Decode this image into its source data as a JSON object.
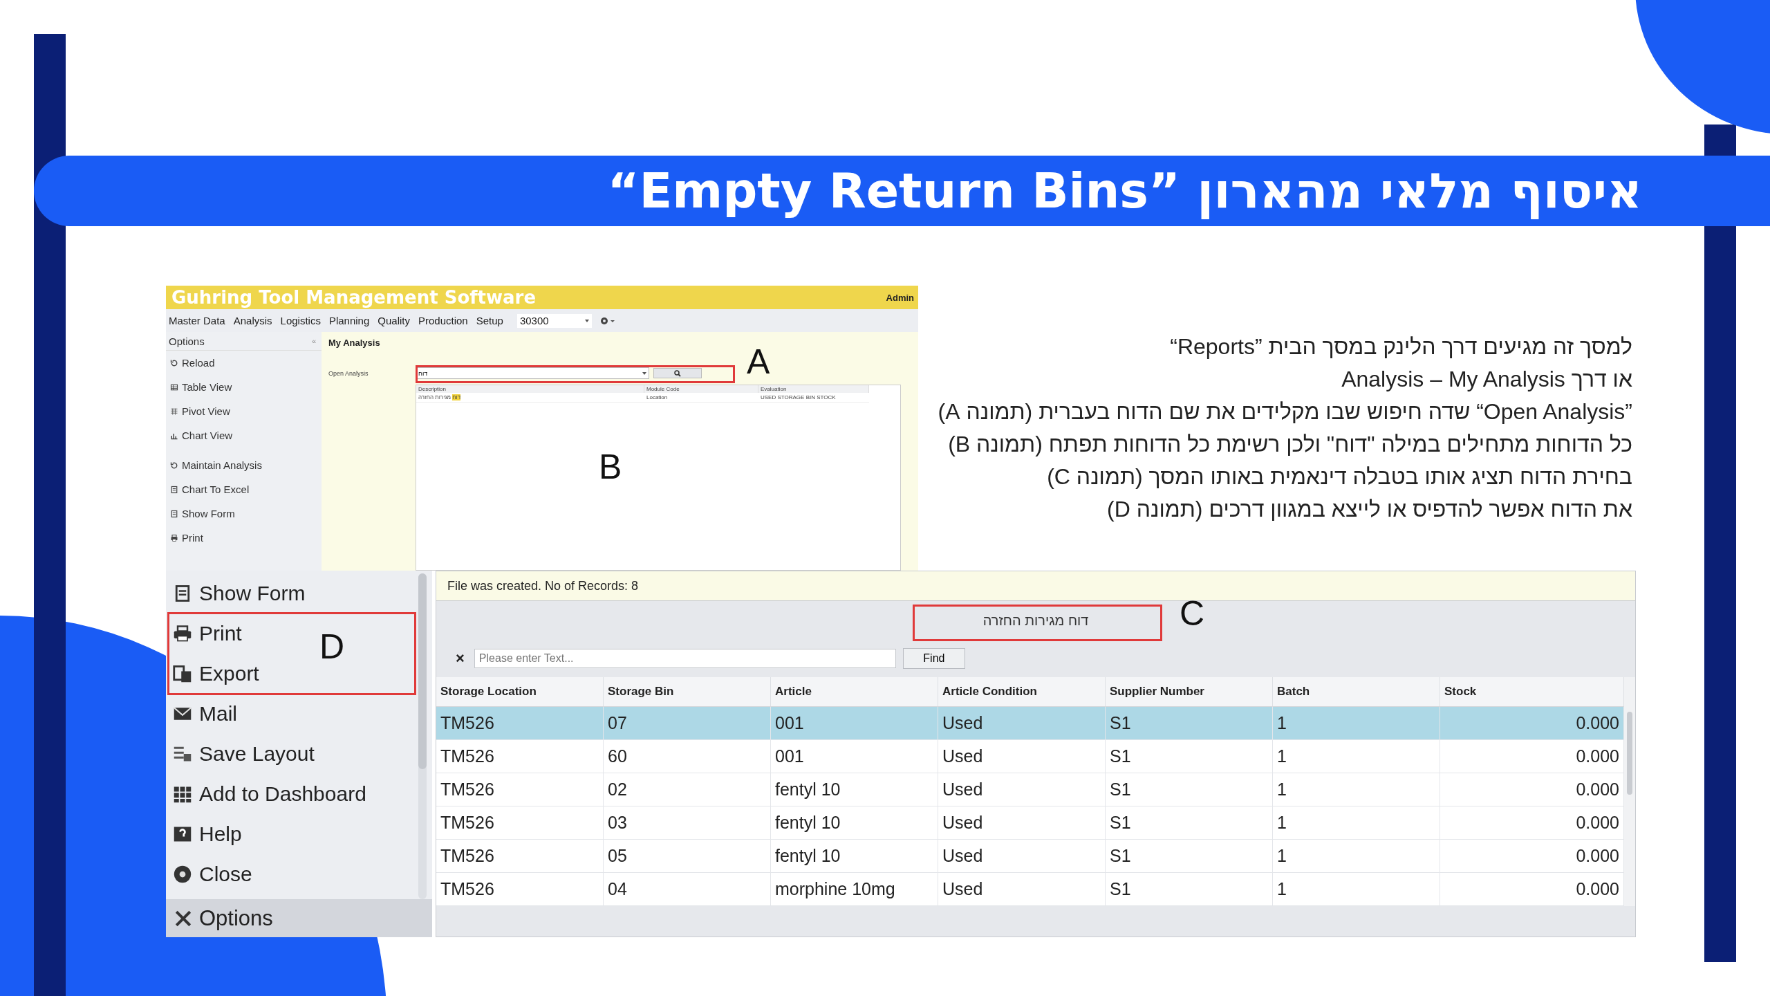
{
  "slide": {
    "title": "איסוף מלאי מהארון ”Empty Return Bins“",
    "notes": [
      "למסך זה מגיעים דרך הלינק במסך הבית ”Reports“",
      "או דרך Analysis – My Analysis",
      "”Open Analysis“ שדה חיפוש שבו מקלידים את שם הדוח בעברית (תמונה A)",
      "כל הדוחות מתחילים במילה \"דוח\" ולכן רשימת כל הדוחות תפתח (תמונה B)",
      "בחירת הדוח תציג אותו בטבלה דינאמית באותו המסך  (תמונה C)",
      "את הדוח אפשר להדפיס או לייצא במגוון דרכים (תמונה D)"
    ]
  },
  "analysis_window": {
    "app_title": "Guhring Tool Management Software",
    "user": "Admin",
    "menu": [
      "Master Data",
      "Analysis",
      "Logistics",
      "Planning",
      "Quality",
      "Production",
      "Setup"
    ],
    "company": "30300",
    "sidebar_title": "Options",
    "sidebar_collapse": "«",
    "sidebar_items": [
      "Reload",
      "Table View",
      "Pivot View",
      "Chart View",
      "Maintain Analysis",
      "Chart To Excel",
      "Show Form",
      "Print"
    ],
    "page_title": "My Analysis",
    "field_label": "Open Analysis",
    "search_value": "דוח",
    "results": {
      "columns": [
        "Description",
        "Module Code",
        "Evaluation"
      ],
      "rows": [
        {
          "highlight": "דוח",
          "description": "מגירות החזרה",
          "module_code": "Location",
          "evaluation": "USED STORAGE BIN STOCK"
        }
      ]
    }
  },
  "options_menu": {
    "items": [
      "Show Form",
      "Print",
      "Export",
      "Mail",
      "Save Layout",
      "Add to Dashboard",
      "Help",
      "Close"
    ],
    "footer": "Options"
  },
  "report_window": {
    "status": "File was created. No of Records: 8",
    "report_title": "דוח מגירות החזרה",
    "clear": "×",
    "placeholder": "Please enter Text...",
    "find": "Find",
    "columns": [
      "Storage Location",
      "Storage Bin",
      "Article",
      "Article Condition",
      "Supplier Number",
      "Batch",
      "Stock"
    ],
    "rows": [
      {
        "cells": [
          "TM526",
          "07",
          "001",
          "Used",
          "S1",
          "1",
          "0.000"
        ],
        "selected": true
      },
      {
        "cells": [
          "TM526",
          "60",
          "001",
          "Used",
          "S1",
          "1",
          "0.000"
        ],
        "selected": false
      },
      {
        "cells": [
          "TM526",
          "02",
          "fentyl 10",
          "Used",
          "S1",
          "1",
          "0.000"
        ],
        "selected": false
      },
      {
        "cells": [
          "TM526",
          "03",
          "fentyl 10",
          "Used",
          "S1",
          "1",
          "0.000"
        ],
        "selected": false
      },
      {
        "cells": [
          "TM526",
          "05",
          "fentyl 10",
          "Used",
          "S1",
          "1",
          "0.000"
        ],
        "selected": false
      },
      {
        "cells": [
          "TM526",
          "04",
          "morphine 10mg",
          "Used",
          "S1",
          "1",
          "0.000"
        ],
        "selected": false
      }
    ]
  },
  "callouts": [
    "A",
    "B",
    "C",
    "D"
  ]
}
